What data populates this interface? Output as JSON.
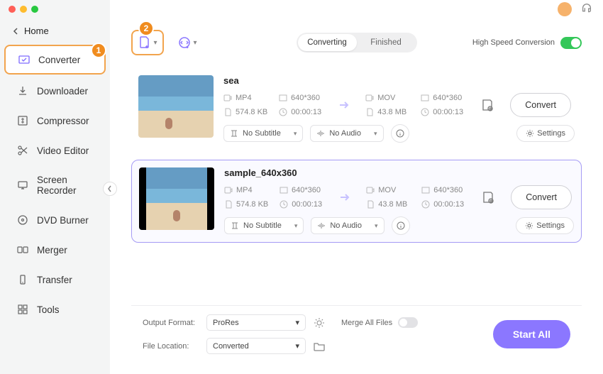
{
  "home": "Home",
  "sidebar": {
    "items": [
      {
        "label": "Converter"
      },
      {
        "label": "Downloader"
      },
      {
        "label": "Compressor"
      },
      {
        "label": "Video Editor"
      },
      {
        "label": "Screen Recorder"
      },
      {
        "label": "DVD Burner"
      },
      {
        "label": "Merger"
      },
      {
        "label": "Transfer"
      },
      {
        "label": "Tools"
      }
    ]
  },
  "markers": {
    "m1": "1",
    "m2": "2"
  },
  "tabs": {
    "converting": "Converting",
    "finished": "Finished"
  },
  "hwspeed": "High Speed Conversion",
  "cards": [
    {
      "title": "sea",
      "left": {
        "fmt": "MP4",
        "res": "640*360",
        "size": "574.8 KB",
        "dur": "00:00:13"
      },
      "right": {
        "fmt": "MOV",
        "res": "640*360",
        "size": "43.8 MB",
        "dur": "00:00:13"
      },
      "subtitle": "No Subtitle",
      "audio": "No Audio",
      "settings": "Settings",
      "convert": "Convert"
    },
    {
      "title": "sample_640x360",
      "left": {
        "fmt": "MP4",
        "res": "640*360",
        "size": "574.8 KB",
        "dur": "00:00:13"
      },
      "right": {
        "fmt": "MOV",
        "res": "640*360",
        "size": "43.8 MB",
        "dur": "00:00:13"
      },
      "subtitle": "No Subtitle",
      "audio": "No Audio",
      "settings": "Settings",
      "convert": "Convert"
    }
  ],
  "bottom": {
    "output_format_label": "Output Format:",
    "output_format_value": "ProRes",
    "file_location_label": "File Location:",
    "file_location_value": "Converted",
    "merge": "Merge All Files",
    "start_all": "Start All"
  }
}
